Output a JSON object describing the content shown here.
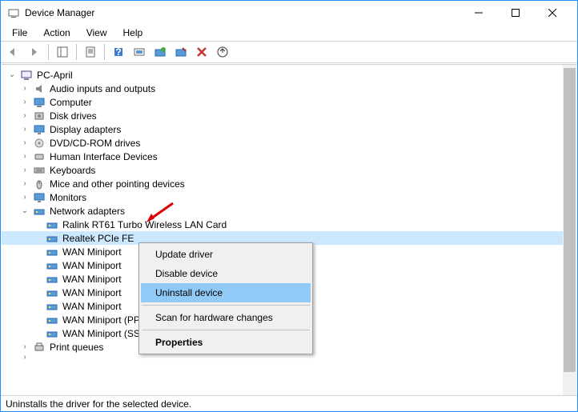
{
  "window": {
    "title": "Device Manager"
  },
  "menu": {
    "file": "File",
    "action": "Action",
    "view": "View",
    "help": "Help"
  },
  "tree": {
    "root": "PC-April",
    "categories": [
      {
        "label": "Audio inputs and outputs",
        "icon": "audio"
      },
      {
        "label": "Computer",
        "icon": "computer"
      },
      {
        "label": "Disk drives",
        "icon": "disk"
      },
      {
        "label": "Display adapters",
        "icon": "display"
      },
      {
        "label": "DVD/CD-ROM drives",
        "icon": "dvd"
      },
      {
        "label": "Human Interface Devices",
        "icon": "hid"
      },
      {
        "label": "Keyboards",
        "icon": "keyboard"
      },
      {
        "label": "Mice and other pointing devices",
        "icon": "mouse"
      },
      {
        "label": "Monitors",
        "icon": "monitor"
      }
    ],
    "network": {
      "label": "Network adapters",
      "children": [
        "Ralink RT61 Turbo Wireless LAN Card",
        "Realtek PCIe FE",
        "WAN Miniport",
        "WAN Miniport",
        "WAN Miniport",
        "WAN Miniport",
        "WAN Miniport",
        "WAN Miniport (PPTP)",
        "WAN Miniport (SSTP)"
      ],
      "selected_index": 1
    },
    "after": [
      {
        "label": "Print queues",
        "icon": "printer"
      }
    ]
  },
  "context_menu": {
    "items": [
      "Update driver",
      "Disable device",
      "Uninstall device",
      "Scan for hardware changes",
      "Properties"
    ],
    "highlighted_index": 2
  },
  "statusbar": {
    "text": "Uninstalls the driver for the selected device."
  }
}
